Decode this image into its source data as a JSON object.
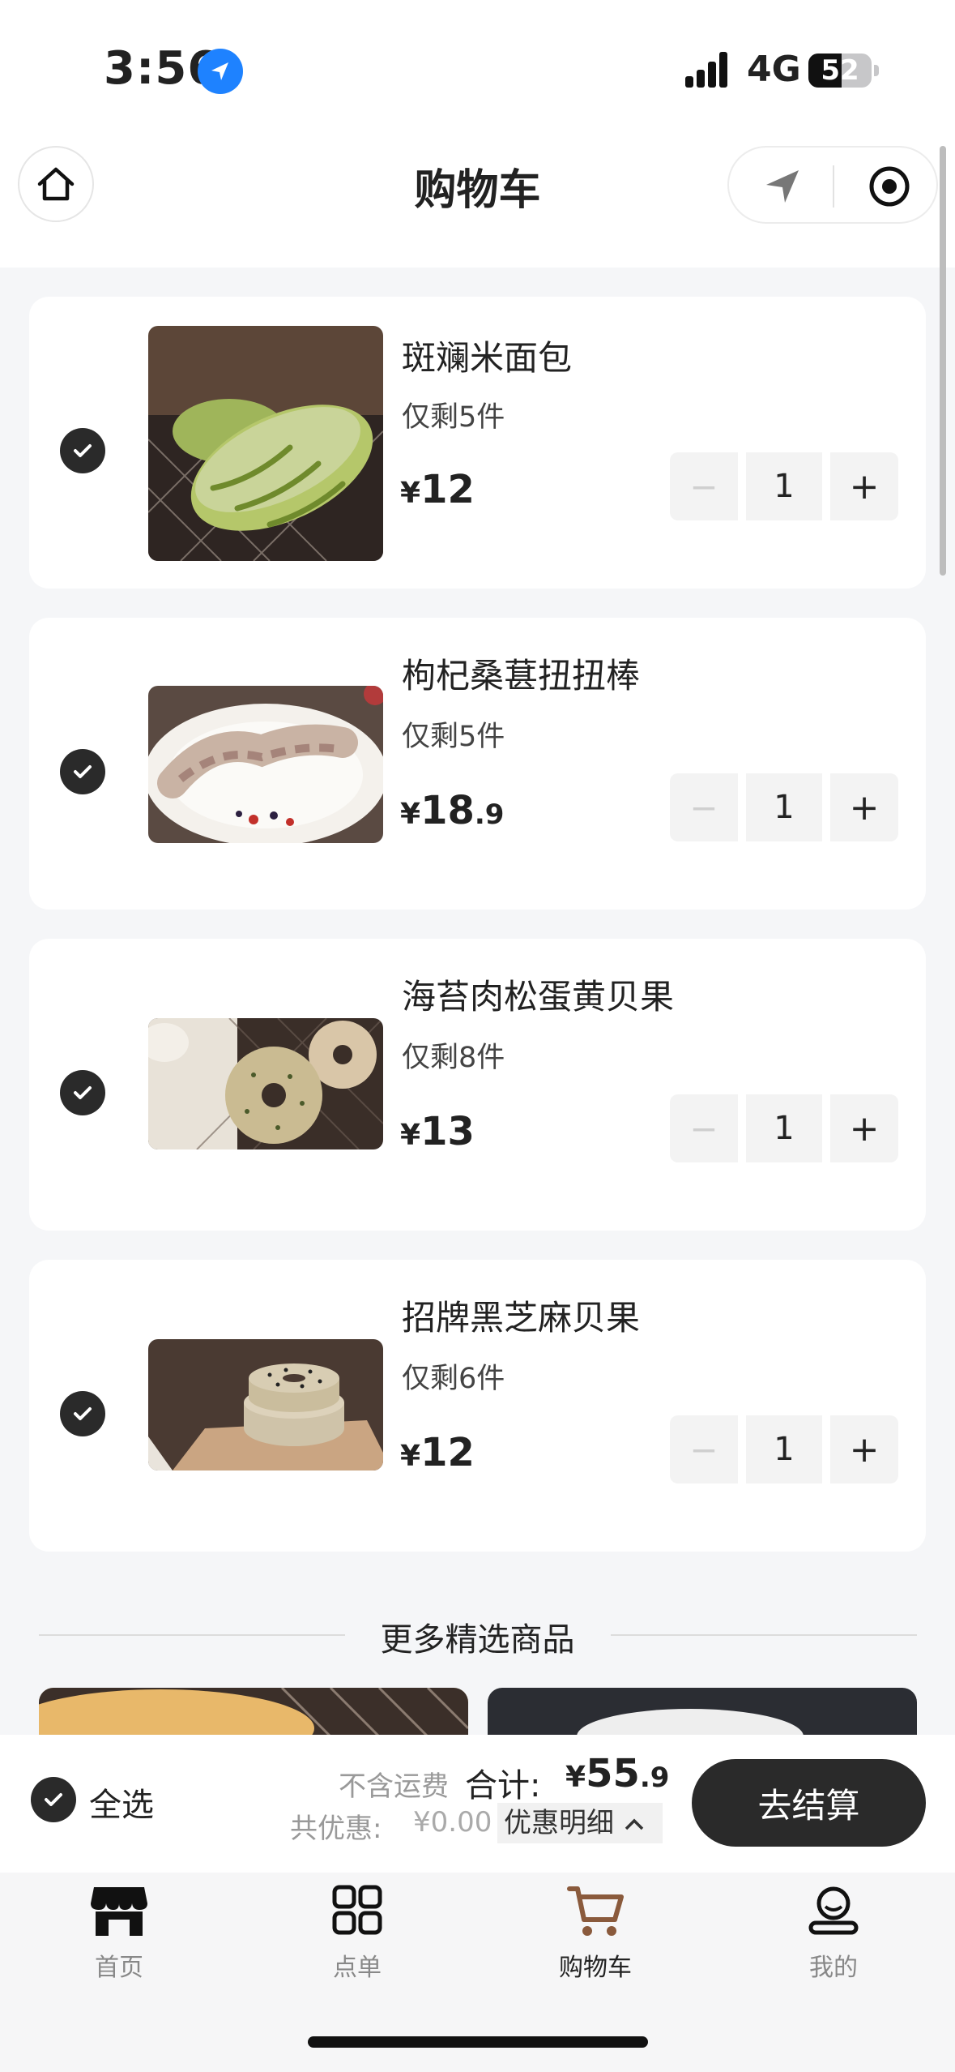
{
  "status_bar": {
    "time": "3:56",
    "network": "4G",
    "battery": "52"
  },
  "header": {
    "title": "购物车"
  },
  "cart_items": [
    {
      "name": "斑斓米面包",
      "stock": "仅剩5件",
      "currency": "¥",
      "price_int": "12",
      "price_dec": "",
      "qty": "1",
      "image": "pandan-bread-photo"
    },
    {
      "name": "枸杞桑葚扭扭棒",
      "stock": "仅剩5件",
      "currency": "¥",
      "price_int": "18",
      "price_dec": ".9",
      "qty": "1",
      "image": "goji-mulberry-twist-photo"
    },
    {
      "name": "海苔肉松蛋黄贝果",
      "stock": "仅剩8件",
      "currency": "¥",
      "price_int": "13",
      "price_dec": "",
      "qty": "1",
      "image": "seaweed-floss-bagel-photo"
    },
    {
      "name": "招牌黑芝麻贝果",
      "stock": "仅剩6件",
      "currency": "¥",
      "price_int": "12",
      "price_dec": "",
      "qty": "1",
      "image": "black-sesame-bagel-photo"
    }
  ],
  "stepper": {
    "minus": "−",
    "plus": "+"
  },
  "more_section": {
    "title": "更多精选商品"
  },
  "checkout": {
    "select_all": "全选",
    "shipping_note": "不含运费",
    "total_label": "合计:",
    "total_currency": "¥",
    "total_int": "55",
    "total_dec": ".9",
    "discount_label": "共优惠:",
    "discount_amount": "¥0.00",
    "discount_detail": "优惠明细",
    "checkout_button": "去结算"
  },
  "tabbar": [
    {
      "label": "首页",
      "icon": "store-icon",
      "active": false
    },
    {
      "label": "点单",
      "icon": "grid-icon",
      "active": false
    },
    {
      "label": "购物车",
      "icon": "cart-icon",
      "active": true
    },
    {
      "label": "我的",
      "icon": "profile-icon",
      "active": false
    }
  ],
  "colors": {
    "accent_dark": "#2a2a2a",
    "cart_brown": "#8a5a3c",
    "location_blue": "#1e82ff"
  }
}
